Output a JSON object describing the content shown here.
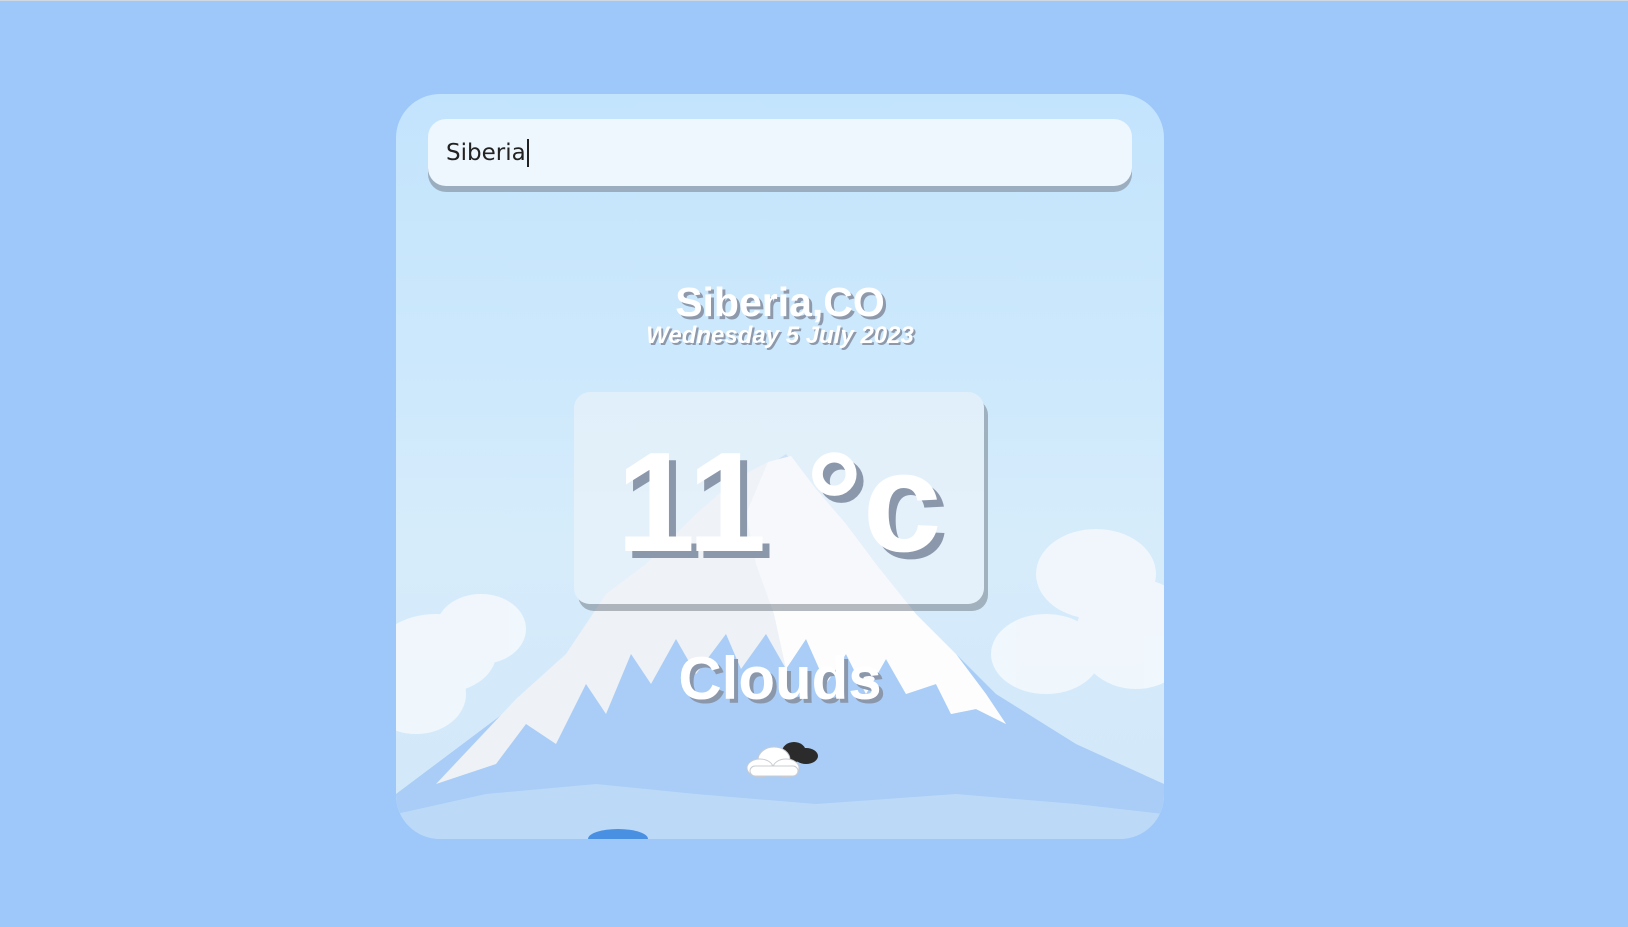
{
  "search": {
    "value": "Siberia"
  },
  "weather": {
    "location": "Siberia,CO",
    "date": "Wednesday 5 July 2023",
    "temperature": "11 °c",
    "condition": "Clouds",
    "condition_icon": "cloud-icon"
  },
  "colors": {
    "page_background": "#9dc8f9",
    "card_sky": "#c3e4fd",
    "text": "#ffffff",
    "text_shadow": "#8b98ab"
  }
}
